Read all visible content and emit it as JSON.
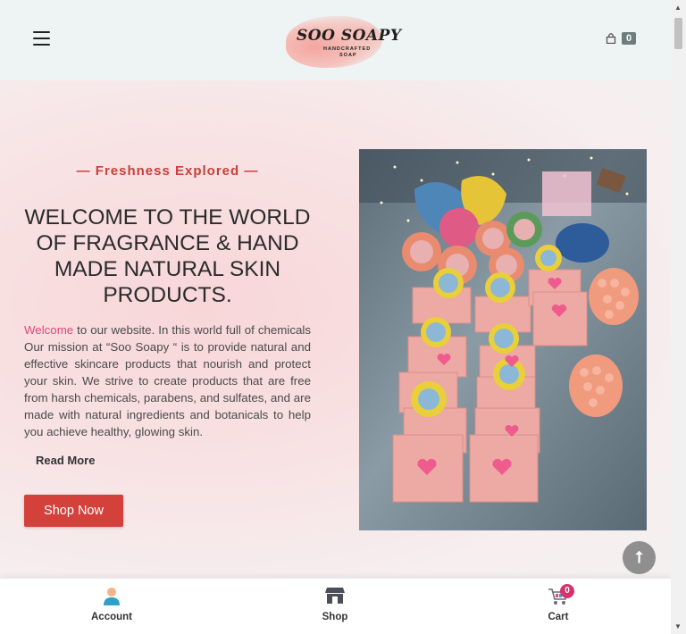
{
  "header": {
    "logo": {
      "title": "SOO SOAPY",
      "sub1": "HANDCRAFTED",
      "sub2": "SOAP"
    },
    "cart_count": "0",
    "icons": {
      "menu": "hamburger-icon",
      "cart": "shopping-bag-icon"
    }
  },
  "hero": {
    "tagline": "— Freshness Explored —",
    "headline": "WELCOME TO THE WORLD OF FRAGRANCE & HAND MADE NATURAL SKIN PRODUCTS.",
    "intro_highlight": "Welcome",
    "intro_rest": " to our website. In this world full of chemicals Our mission at “Soo Soapy “ is to provide natural and effective skincare products that nourish and protect your skin. We strive to create products that are free from harsh chemicals, parabens, and sulfates, and are made with natural ingredients and botanicals to help you achieve healthy, glowing skin.",
    "read_more": "Read More",
    "shop_now": "Shop Now",
    "back_to_top_icon": "arrow-up-icon"
  },
  "bottom_nav": {
    "account": {
      "label": "Account",
      "icon": "user-icon"
    },
    "shop": {
      "label": "Shop",
      "icon": "store-icon"
    },
    "cart": {
      "label": "Cart",
      "icon": "cart-icon",
      "badge": "0"
    }
  },
  "colors": {
    "accent": "#d4403a",
    "tagline": "#c8403a",
    "highlight": "#d94a7a",
    "badge": "#d6336c",
    "header_bg": "#eef3f4"
  }
}
